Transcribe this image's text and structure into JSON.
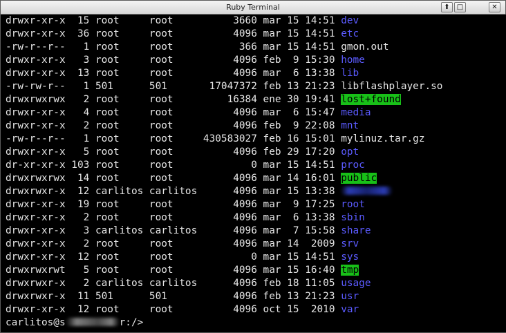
{
  "window": {
    "title": "Ruby Terminal",
    "buttons": {
      "up": "⬆",
      "maximize": "□",
      "close": "✕"
    }
  },
  "listing": [
    {
      "perms": "drwxr-xr-x",
      "links": "15",
      "owner": "root",
      "group": "root",
      "size": "3660",
      "month": "mar",
      "day": "15",
      "time": "14:51",
      "name": "dev",
      "type": "dir"
    },
    {
      "perms": "drwxr-xr-x",
      "links": "36",
      "owner": "root",
      "group": "root",
      "size": "4096",
      "month": "mar",
      "day": "15",
      "time": "14:51",
      "name": "etc",
      "type": "dir"
    },
    {
      "perms": "-rw-r--r--",
      "links": "1",
      "owner": "root",
      "group": "root",
      "size": "366",
      "month": "mar",
      "day": "15",
      "time": "14:51",
      "name": "gmon.out",
      "type": "file"
    },
    {
      "perms": "drwxr-xr-x",
      "links": "3",
      "owner": "root",
      "group": "root",
      "size": "4096",
      "month": "feb",
      "day": "9",
      "time": "15:30",
      "name": "home",
      "type": "dir"
    },
    {
      "perms": "drwxr-xr-x",
      "links": "13",
      "owner": "root",
      "group": "root",
      "size": "4096",
      "month": "mar",
      "day": "6",
      "time": "13:38",
      "name": "lib",
      "type": "dir"
    },
    {
      "perms": "-rw-rw-r--",
      "links": "1",
      "owner": "501",
      "group": "501",
      "size": "17047372",
      "month": "feb",
      "day": "13",
      "time": "21:23",
      "name": "libflashplayer.so",
      "type": "file"
    },
    {
      "perms": "drwxrwxrwx",
      "links": "2",
      "owner": "root",
      "group": "root",
      "size": "16384",
      "month": "ene",
      "day": "30",
      "time": "19:41",
      "name": "lost+found",
      "type": "sticky"
    },
    {
      "perms": "drwxr-xr-x",
      "links": "4",
      "owner": "root",
      "group": "root",
      "size": "4096",
      "month": "mar",
      "day": "6",
      "time": "15:47",
      "name": "media",
      "type": "dir"
    },
    {
      "perms": "drwxr-xr-x",
      "links": "2",
      "owner": "root",
      "group": "root",
      "size": "4096",
      "month": "feb",
      "day": "9",
      "time": "22:08",
      "name": "mnt",
      "type": "dir"
    },
    {
      "perms": "-rw-r--r--",
      "links": "1",
      "owner": "root",
      "group": "root",
      "size": "430583027",
      "month": "feb",
      "day": "16",
      "time": "15:01",
      "name": "mylinuz.tar.gz",
      "type": "file"
    },
    {
      "perms": "drwxr-xr-x",
      "links": "5",
      "owner": "root",
      "group": "root",
      "size": "4096",
      "month": "feb",
      "day": "29",
      "time": "17:20",
      "name": "opt",
      "type": "dir"
    },
    {
      "perms": "dr-xr-xr-x",
      "links": "103",
      "owner": "root",
      "group": "root",
      "size": "0",
      "month": "mar",
      "day": "15",
      "time": "14:51",
      "name": "proc",
      "type": "dir"
    },
    {
      "perms": "drwxrwxrwx",
      "links": "14",
      "owner": "root",
      "group": "root",
      "size": "4096",
      "month": "mar",
      "day": "14",
      "time": "16:01",
      "name": "public",
      "type": "sticky"
    },
    {
      "perms": "drwxrwxr-x",
      "links": "12",
      "owner": "carlitos",
      "group": "carlitos",
      "size": "4096",
      "month": "mar",
      "day": "15",
      "time": "13:38",
      "name": "",
      "type": "redacted"
    },
    {
      "perms": "drwxr-xr-x",
      "links": "19",
      "owner": "root",
      "group": "root",
      "size": "4096",
      "month": "mar",
      "day": "9",
      "time": "17:25",
      "name": "root",
      "type": "dir"
    },
    {
      "perms": "drwxr-xr-x",
      "links": "2",
      "owner": "root",
      "group": "root",
      "size": "4096",
      "month": "mar",
      "day": "6",
      "time": "13:38",
      "name": "sbin",
      "type": "dir"
    },
    {
      "perms": "drwxr-xr-x",
      "links": "3",
      "owner": "carlitos",
      "group": "carlitos",
      "size": "4096",
      "month": "mar",
      "day": "7",
      "time": "15:58",
      "name": "share",
      "type": "dir"
    },
    {
      "perms": "drwxr-xr-x",
      "links": "2",
      "owner": "root",
      "group": "root",
      "size": "4096",
      "month": "mar",
      "day": "14",
      "time": "2009",
      "name": "srv",
      "type": "dir"
    },
    {
      "perms": "drwxr-xr-x",
      "links": "12",
      "owner": "root",
      "group": "root",
      "size": "0",
      "month": "mar",
      "day": "15",
      "time": "14:51",
      "name": "sys",
      "type": "dir"
    },
    {
      "perms": "drwxrwxrwt",
      "links": "5",
      "owner": "root",
      "group": "root",
      "size": "4096",
      "month": "mar",
      "day": "15",
      "time": "16:40",
      "name": "tmp",
      "type": "sticky"
    },
    {
      "perms": "drwxrwxr-x",
      "links": "2",
      "owner": "carlitos",
      "group": "carlitos",
      "size": "4096",
      "month": "feb",
      "day": "18",
      "time": "11:05",
      "name": "usage",
      "type": "dir"
    },
    {
      "perms": "drwxrwxr-x",
      "links": "11",
      "owner": "501",
      "group": "501",
      "size": "4096",
      "month": "feb",
      "day": "13",
      "time": "21:23",
      "name": "usr",
      "type": "dir"
    },
    {
      "perms": "drwxr-xr-x",
      "links": "12",
      "owner": "root",
      "group": "root",
      "size": "4096",
      "month": "oct",
      "day": "15",
      "time": "2010",
      "name": "var",
      "type": "dir"
    }
  ],
  "prompt": {
    "user": "carlitos@s",
    "suffix": "r:/>"
  },
  "colors": {
    "background": "#000000",
    "text": "#e6e6e6",
    "dir": "#5b5bff",
    "sticky_bg": "#18c018"
  }
}
